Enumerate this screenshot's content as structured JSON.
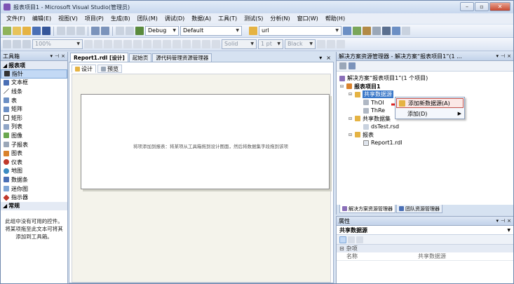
{
  "window": {
    "title": "报表项目1 - Microsoft Visual Studio(管理员)"
  },
  "menu": [
    "文件(F)",
    "编辑(E)",
    "视图(V)",
    "项目(P)",
    "生成(B)",
    "团队(M)",
    "调试(D)",
    "数据(A)",
    "工具(T)",
    "测试(S)",
    "分析(N)",
    "窗口(W)",
    "帮助(H)"
  ],
  "toolbar": {
    "config": "Debug",
    "platform": "Default",
    "search": "url",
    "zoom": "100%",
    "line_style": "Solid",
    "line_width": "1 pt",
    "line_color": "Black"
  },
  "toolbox": {
    "title": "工具箱",
    "group_label": "报表项",
    "items": [
      "指针",
      "文本框",
      "线条",
      "表",
      "矩阵",
      "矩形",
      "列表",
      "图像",
      "子报表",
      "图表",
      "仪表",
      "地图",
      "数据条",
      "迷你图",
      "指示器"
    ],
    "general_group": "常规",
    "note": "此组中没有可用的控件。将某项拖至此文本可将其添加到工具箱。"
  },
  "document": {
    "tabs": [
      "Report1.rdl [设计]",
      "起始页",
      "源代码管理资源管理器"
    ],
    "subtabs": [
      "设计",
      "预览"
    ],
    "canvas_message": "将项添加到报表：将某项从工具箱拖到设计图面，然后将数据集字段拖到该项"
  },
  "solution_explorer": {
    "title": "解决方案资源管理器 - 解决方案“报表项目1”(1 ...",
    "solution": "解决方案“报表项目1”(1 个项目)",
    "project": "报表项目1",
    "shared_datasources": "共享数据源",
    "ds1": "ThOl",
    "ds2": "ThRe",
    "shared_datasets": "共享数据集",
    "dataset1": "dsTest.rsd",
    "reports": "报表",
    "report1": "Report1.rdl",
    "tabs": [
      "解决方案资源管理器",
      "团队资源管理器"
    ]
  },
  "context_menu": {
    "items": [
      "添加新数据源(A)",
      "添加(D)"
    ]
  },
  "properties": {
    "title": "属性",
    "object": "共享数据源",
    "category": "杂项",
    "rows": [
      {
        "key": "名称",
        "value": "共享数据源"
      }
    ]
  },
  "colors": {
    "accent": "#3a78c9",
    "highlight_border": "#c1504a"
  }
}
